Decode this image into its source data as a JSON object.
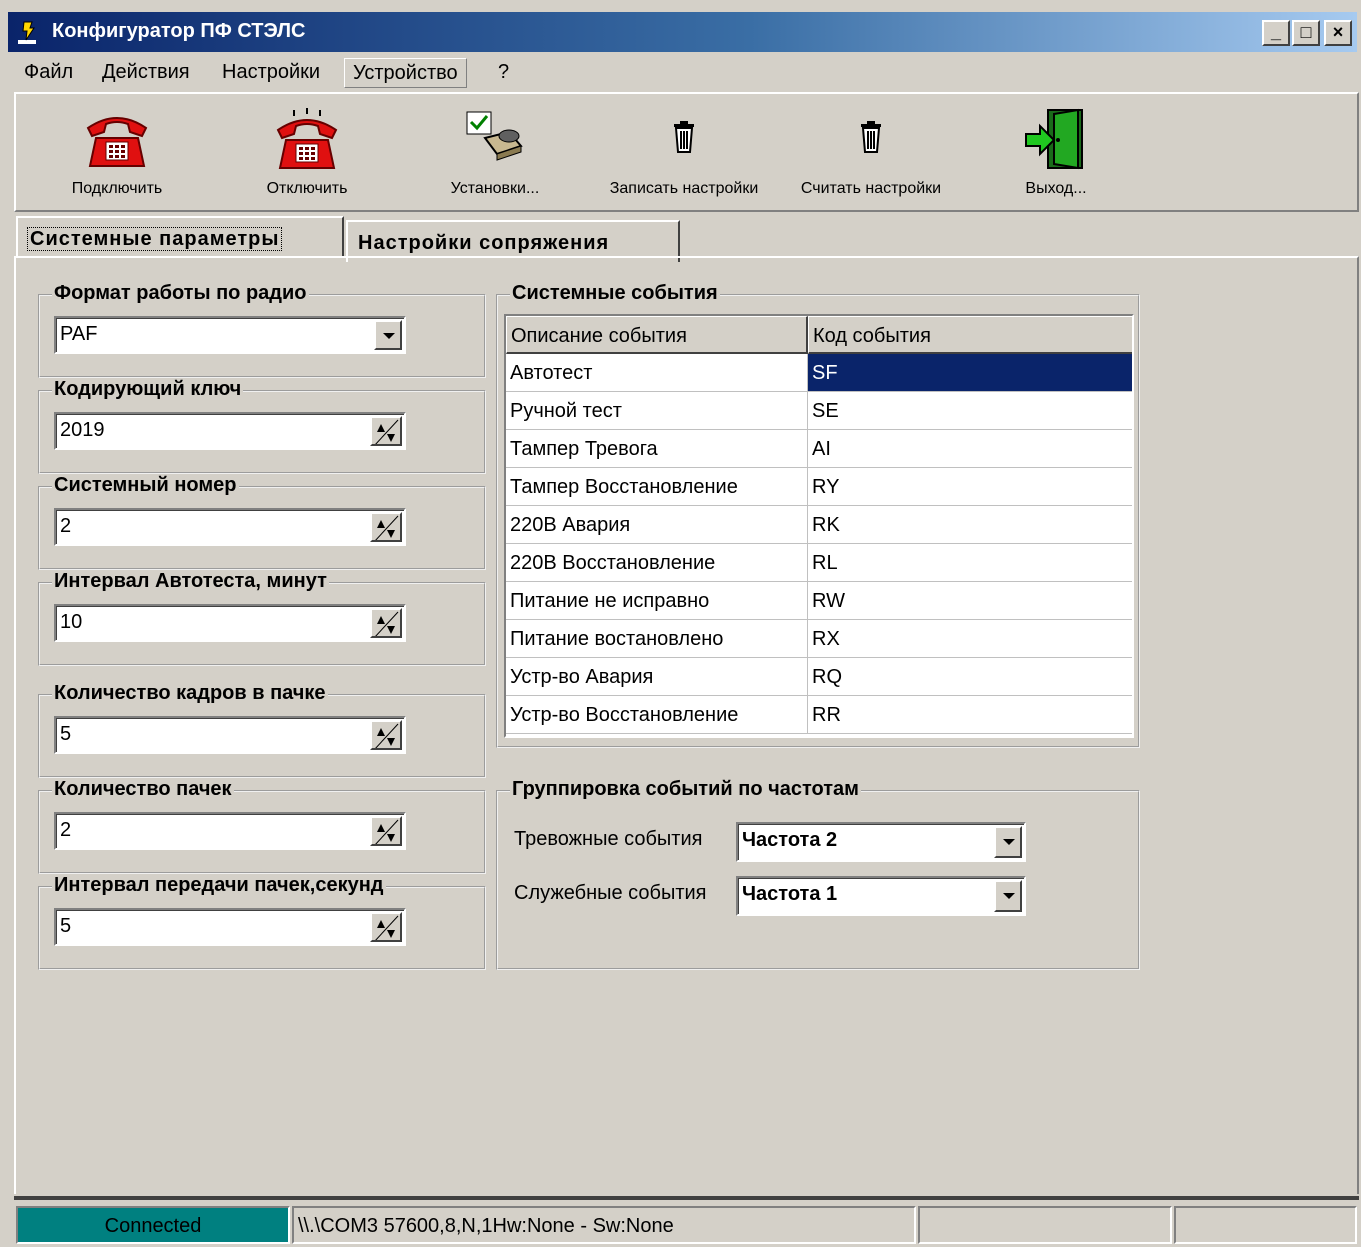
{
  "window": {
    "title": "Конфигуратор ПФ СТЭЛС",
    "minimize": "_",
    "maximize": "□",
    "close": "×"
  },
  "menu": {
    "items": [
      {
        "label": "Файл"
      },
      {
        "label": "Действия"
      },
      {
        "label": "Настройки"
      },
      {
        "label": "Устройство"
      },
      {
        "label": "?"
      }
    ]
  },
  "toolbar": {
    "buttons": [
      {
        "label": "Подключить",
        "icon": "phone-icon"
      },
      {
        "label": "Отключить",
        "icon": "phone-icon"
      },
      {
        "label": "Установки...",
        "icon": "settings-icon"
      },
      {
        "label": "Записать настройки",
        "icon": "trash-icon"
      },
      {
        "label": "Считать настройки",
        "icon": "trash-icon"
      },
      {
        "label": "Выход...",
        "icon": "exit-door-icon"
      }
    ]
  },
  "tabs": [
    {
      "label": "Системные параметры",
      "selected": true
    },
    {
      "label": "Настройки сопряжения",
      "selected": false
    }
  ],
  "system_params": {
    "radio_format": {
      "legend": "Формат работы по радио",
      "value": "PAF"
    },
    "coding_key": {
      "legend": "Кодирующий ключ",
      "value": "2019"
    },
    "system_number": {
      "legend": "Системный номер",
      "value": "2"
    },
    "autotest_interval": {
      "legend": "Интервал Автотеста, минут",
      "value": "10"
    },
    "frames_per_pack": {
      "legend": "Количество кадров в пачке",
      "value": "5"
    },
    "pack_count": {
      "legend": "Количество пачек",
      "value": "2"
    },
    "pack_interval": {
      "legend": "Интервал передачи пачек,секунд",
      "value": "5"
    }
  },
  "events": {
    "legend": "Системные события",
    "columns": [
      "Описание события",
      "Код события"
    ],
    "rows": [
      {
        "desc": "Автотест",
        "code": "SF"
      },
      {
        "desc": "Ручной тест",
        "code": "SE"
      },
      {
        "desc": "Тампер Тревога",
        "code": "AI"
      },
      {
        "desc": "Тампер Восстановление",
        "code": "RY"
      },
      {
        "desc": "220В Авария",
        "code": "RK"
      },
      {
        "desc": "220В Восстановление",
        "code": "RL"
      },
      {
        "desc": "Питание не исправно",
        "code": "RW"
      },
      {
        "desc": "Питание востановлено",
        "code": "RX"
      },
      {
        "desc": "Устр-во Авария",
        "code": "RQ"
      },
      {
        "desc": "Устр-во Восстановление",
        "code": "RR"
      }
    ]
  },
  "grouping": {
    "legend": "Группировка событий по частотам",
    "alarm": {
      "label": "Тревожные события",
      "value": "Частота 2"
    },
    "service": {
      "label": "Служебные события",
      "value": "Частота 1"
    }
  },
  "status": {
    "connection": "Connected",
    "port": "\\\\.\\COM3  57600,8,N,1Hw:None - Sw:None",
    "connected_color": "#008080"
  }
}
